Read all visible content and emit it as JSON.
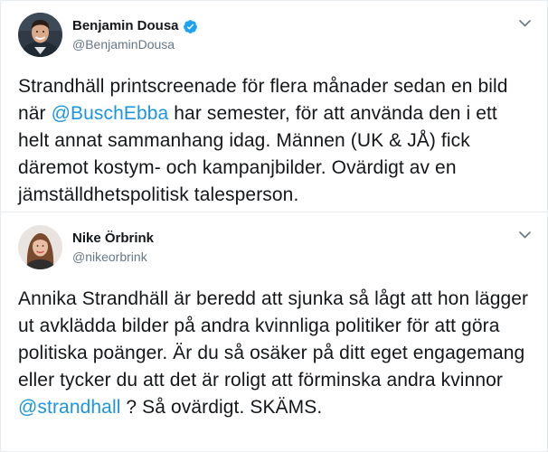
{
  "tweets": [
    {
      "display_name": "Benjamin Dousa",
      "handle": "@BenjaminDousa",
      "verified": true,
      "avatar_icon": "user-avatar-man",
      "text_parts": [
        "Strandhäll printscreenade för flera månader sedan en bild när ",
        "@BuschEbba",
        " har semester, för att använda den i ett helt annat sammanhang idag. Männen (UK & JÅ) fick däremot kostym- och kampanjbilder. Ovärdigt av en jämställdhetspolitisk talesperson."
      ]
    },
    {
      "display_name": "Nike Örbrink",
      "handle": "@nikeorbrink",
      "verified": false,
      "avatar_icon": "user-avatar-woman",
      "text_parts": [
        "Annika Strandhäll är beredd att sjunka så lågt att hon lägger ut avklädda bilder på andra kvinnliga politiker för att göra politiska poänger. Är du så osäker på ditt eget engagemang eller tycker du att det är roligt att förminska andra kvinnor ",
        "@strandhall",
        " ? Så ovärdigt. SKÄMS."
      ]
    }
  ],
  "colors": {
    "link": "#1b95e0",
    "verified": "#1da1f2",
    "secondary_text": "#657786",
    "divider": "#e6ecf0"
  },
  "icons": {
    "menu": "chevron-down-icon",
    "verified": "verified-badge-icon"
  }
}
